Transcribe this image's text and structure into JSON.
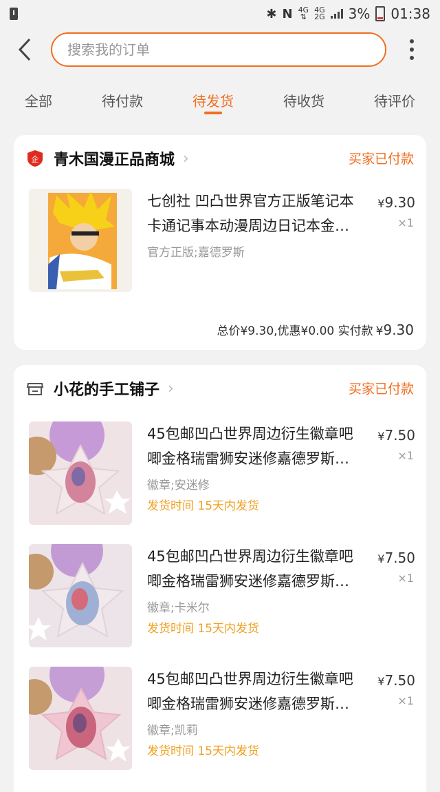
{
  "status_bar": {
    "network_top": "4G",
    "network_bottom": "4G",
    "network_mid": "2G",
    "battery": "3%",
    "time": "01:38"
  },
  "search": {
    "placeholder": "搜索我的订单"
  },
  "tabs": [
    {
      "label": "全部"
    },
    {
      "label": "待付款"
    },
    {
      "label": "待发货"
    },
    {
      "label": "待收货"
    },
    {
      "label": "待评价"
    }
  ],
  "active_tab": "待发货",
  "accent_color": "#f26d1f",
  "orders": [
    {
      "shop_name": "青木国漫正品商城",
      "status": "买家已付款",
      "items": [
        {
          "title_line1": "七创社 凹凸世界官方正版笔记本",
          "title_line2": "卡通记事本动漫周边日记本金…",
          "sku": "官方正版;嘉德罗斯",
          "price_symbol": "¥",
          "price": "9.30",
          "qty": "×1"
        }
      ],
      "total_label": "总价¥9.30,优惠¥0.00 实付款",
      "paid_symbol": "¥",
      "paid": "9.30"
    },
    {
      "shop_name": "小花的手工铺子",
      "status": "买家已付款",
      "items": [
        {
          "title_line1": "45包邮凹凸世界周边衍生徽章吧",
          "title_line2": "唧金格瑞雷狮安迷修嘉德罗斯…",
          "sku": "徽章;安迷修",
          "ship": "发货时间 15天内发货",
          "price_symbol": "¥",
          "price": "7.50",
          "qty": "×1"
        },
        {
          "title_line1": "45包邮凹凸世界周边衍生徽章吧",
          "title_line2": "唧金格瑞雷狮安迷修嘉德罗斯…",
          "sku": "徽章;卡米尔",
          "ship": "发货时间 15天内发货",
          "price_symbol": "¥",
          "price": "7.50",
          "qty": "×1"
        },
        {
          "title_line1": "45包邮凹凸世界周边衍生徽章吧",
          "title_line2": "唧金格瑞雷狮安迷修嘉德罗斯…",
          "sku": "徽章;凯莉",
          "ship": "发货时间 15天内发货",
          "price_symbol": "¥",
          "price": "7.50",
          "qty": "×1"
        }
      ]
    }
  ]
}
